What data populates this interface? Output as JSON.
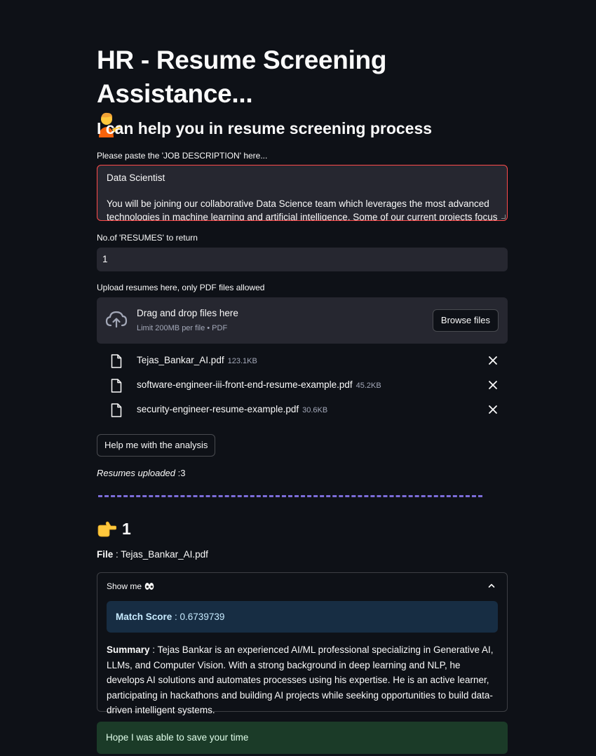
{
  "header": {
    "title": "HR - Resume Screening Assistance...",
    "subtitle": "I can help you in resume screening process"
  },
  "job_description": {
    "label": "Please paste the 'JOB DESCRIPTION' here...",
    "lines": [
      "Data Scientist",
      "",
      "You will be joining our collaborative Data Science team which leverages the most advanced",
      "technologies in machine learning and artificial intelligence. Some of our current projects focus on"
    ]
  },
  "num_resumes": {
    "label": "No.of 'RESUMES' to return",
    "value": "1"
  },
  "upload": {
    "label": "Upload resumes here, only PDF files allowed",
    "drag_text": "Drag and drop files here",
    "limit_text": "Limit 200MB per file • PDF",
    "browse_label": "Browse files",
    "files": [
      {
        "name": "Tejas_Bankar_AI.pdf",
        "size": "123.1KB"
      },
      {
        "name": "software-engineer-iii-front-end-resume-example.pdf",
        "size": "45.2KB"
      },
      {
        "name": "security-engineer-resume-example.pdf",
        "size": "30.6KB"
      }
    ]
  },
  "actions": {
    "analyze_label": "Help me with the analysis"
  },
  "status": {
    "uploaded_label": "Resumes uploaded",
    "uploaded_count": " :3"
  },
  "result": {
    "rank": "1",
    "file_label": "File",
    "file_value": " : Tejas_Bankar_AI.pdf",
    "expander_label": "Show me",
    "match_label": "Match Score",
    "match_value": " : 0.6739739",
    "summary_label": "Summary",
    "summary_text": " : Tejas Bankar is an experienced AI/ML professional specializing in Generative AI, LLMs, and Computer Vision. With a strong background in deep learning and NLP, he develops AI solutions and automates processes using his expertise. He is an active learner, participating in hackathons and building AI projects while seeking opportunities to build data-driven intelligent systems."
  },
  "footer_message": "Hope I was able to save your time",
  "colors": {
    "background": "#0e1117",
    "input_bg": "#262730",
    "focus_border": "#ff4b4b",
    "divider": "#7b6cd9",
    "info_bg": "#172d43",
    "success_bg": "#1b3b28"
  },
  "icons": {
    "title_emoji": "person-tipping-hand-icon",
    "rank_emoji": "pointing-right-icon",
    "expander_emoji": "eyes-icon"
  }
}
